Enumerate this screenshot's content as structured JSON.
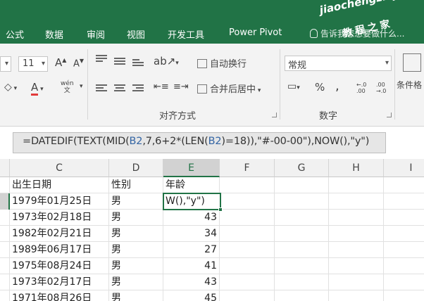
{
  "ribbon_tabs": [
    "公式",
    "数据",
    "审阅",
    "视图",
    "开发工具",
    "Power Pivot"
  ],
  "tell_me": "告诉我您想要做什么...",
  "watermark": {
    "line1": "jiaochengzhijia.com",
    "line2": "教程之家"
  },
  "font": {
    "size": "11",
    "grow": "A",
    "shrink": "A",
    "font_color": "A",
    "phonetic": "wén"
  },
  "alignment": {
    "wrap_text": "自动换行",
    "merge_center": "合并后居中",
    "group_label": "对齐方式"
  },
  "number": {
    "format": "常规",
    "percent": "%",
    "comma": ",",
    "inc_decimal": "←.0 .00",
    "dec_decimal": ".00 →.0",
    "group_label": "数字"
  },
  "styles": {
    "conditional": "条件格"
  },
  "formula_bar": {
    "parts": [
      {
        "text": "=DATEDIF(TEXT(MID(",
        "color": "#333333"
      },
      {
        "text": "B2",
        "color": "#3465a4"
      },
      {
        "text": ",7,6+2*(LEN(",
        "color": "#333333"
      },
      {
        "text": "B2",
        "color": "#3465a4"
      },
      {
        "text": ")=18)),\"#-00-00\"),NOW(),\"y\")",
        "color": "#333333"
      }
    ]
  },
  "columns": [
    "C",
    "D",
    "E",
    "F",
    "G",
    "H",
    "I"
  ],
  "rows": [
    {
      "c": "出生日期",
      "d": "性别",
      "e": "年龄"
    },
    {
      "c": "1979年01月25日",
      "d": "男",
      "e": "W(),\"y\")"
    },
    {
      "c": "1973年02月18日",
      "d": "男",
      "e": "43"
    },
    {
      "c": "1982年02月21日",
      "d": "男",
      "e": "34"
    },
    {
      "c": "1989年06月17日",
      "d": "男",
      "e": "27"
    },
    {
      "c": "1975年08月24日",
      "d": "男",
      "e": "41"
    },
    {
      "c": "1973年02月17日",
      "d": "男",
      "e": "43"
    },
    {
      "c": "1971年08月26日",
      "d": "男",
      "e": "45"
    }
  ],
  "colors": {
    "excel_green": "#217346",
    "cell_ref_blue": "#3465a4"
  }
}
